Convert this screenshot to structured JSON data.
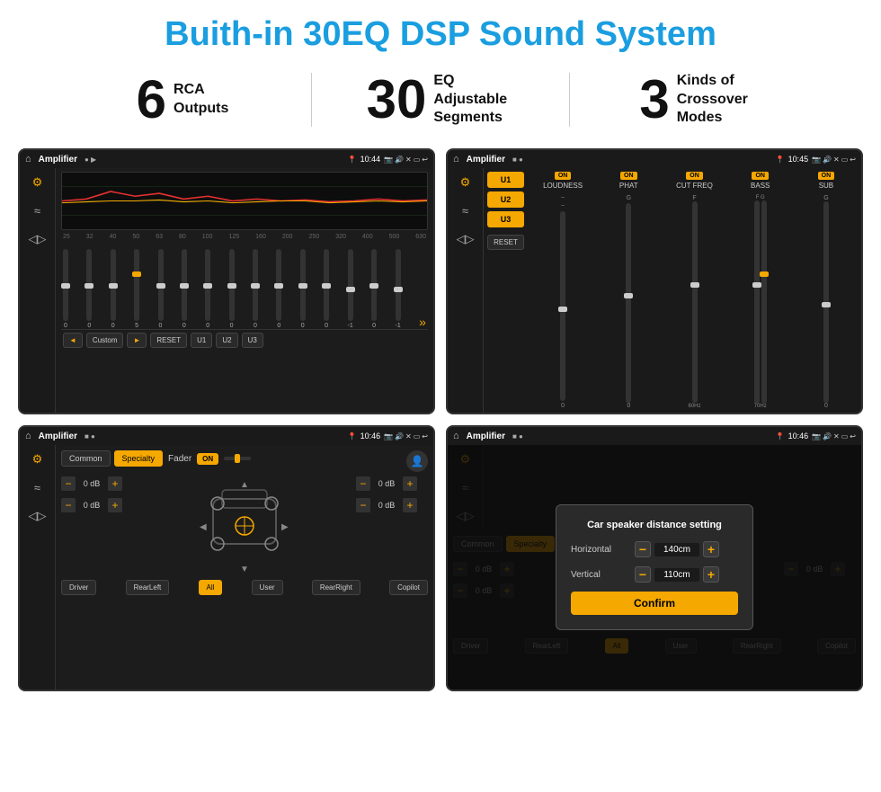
{
  "page": {
    "title": "Buith-in 30EQ DSP Sound System",
    "stats": [
      {
        "number": "6",
        "label": "RCA\nOutputs"
      },
      {
        "number": "30",
        "label": "EQ Adjustable\nSegments"
      },
      {
        "number": "3",
        "label": "Kinds of\nCrossover Modes"
      }
    ]
  },
  "screens": {
    "eq": {
      "status": {
        "app": "Amplifier",
        "time": "10:44"
      },
      "freqs": [
        "25",
        "32",
        "40",
        "50",
        "63",
        "80",
        "100",
        "125",
        "160",
        "200",
        "250",
        "320",
        "400",
        "500",
        "630"
      ],
      "values": [
        "0",
        "0",
        "0",
        "5",
        "0",
        "0",
        "0",
        "0",
        "0",
        "0",
        "0",
        "0",
        "-1",
        "0",
        "-1"
      ],
      "preset": "Custom",
      "buttons": [
        "RESET",
        "U1",
        "U2",
        "U3"
      ]
    },
    "crossover": {
      "status": {
        "app": "Amplifier",
        "time": "10:45"
      },
      "presets": [
        "U1",
        "U2",
        "U3"
      ],
      "columns": [
        {
          "badge": "ON",
          "title": "LOUDNESS"
        },
        {
          "badge": "ON",
          "title": "PHAT"
        },
        {
          "badge": "ON",
          "title": "CUT FREQ"
        },
        {
          "badge": "ON",
          "title": "BASS"
        },
        {
          "badge": "ON",
          "title": "SUB"
        }
      ]
    },
    "fader": {
      "status": {
        "app": "Amplifier",
        "time": "10:46"
      },
      "tabs": [
        "Common",
        "Specialty"
      ],
      "activeTab": "Specialty",
      "faderLabel": "Fader",
      "onToggle": "ON",
      "controls": {
        "topLeft": "0 dB",
        "bottomLeft": "0 dB",
        "topRight": "0 dB",
        "bottomRight": "0 dB"
      },
      "buttons": [
        "Driver",
        "RearLeft",
        "All",
        "User",
        "RearRight",
        "Copilot"
      ]
    },
    "distance": {
      "status": {
        "app": "Amplifier",
        "time": "10:46"
      },
      "tabs": [
        "Common",
        "Specialty"
      ],
      "dialog": {
        "title": "Car speaker distance setting",
        "horizontal": {
          "label": "Horizontal",
          "value": "140cm"
        },
        "vertical": {
          "label": "Vertical",
          "value": "110cm"
        },
        "confirmBtn": "Confirm"
      },
      "controls": {
        "topRight": "0 dB",
        "bottomRight": "0 dB"
      },
      "buttons": [
        "Driver",
        "RearLeft",
        "All",
        "User",
        "RearRight",
        "Copilot"
      ]
    }
  }
}
